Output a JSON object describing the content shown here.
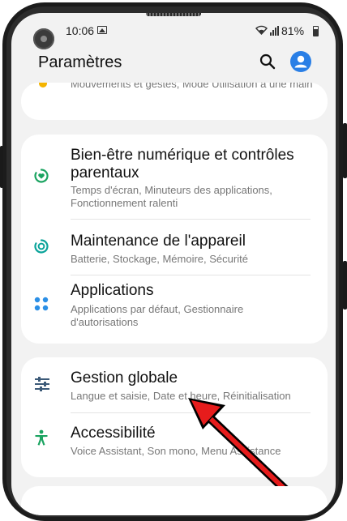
{
  "status_bar": {
    "time": "10:06",
    "battery": "81%"
  },
  "header": {
    "title": "Paramètres"
  },
  "top_card": {
    "partial_text": "Mouvements et gestes, Mode Utilisation à une main"
  },
  "group1": [
    {
      "label": "Bien-être numérique et contrôles parentaux",
      "sub": "Temps d'écran, Minuteurs des applications, Fonctionnement ralenti",
      "icon": "digital-wellbeing-icon"
    },
    {
      "label": "Maintenance de l'appareil",
      "sub": "Batterie, Stockage, Mémoire, Sécurité",
      "icon": "device-care-icon"
    },
    {
      "label": "Applications",
      "sub": "Applications par défaut, Gestionnaire d'autorisations",
      "icon": "apps-icon"
    }
  ],
  "group2": [
    {
      "label": "Gestion globale",
      "sub": "Langue et saisie, Date et heure, Réinitialisation",
      "icon": "sliders-icon"
    },
    {
      "label": "Accessibilité",
      "sub": "Voice Assistant, Son mono, Menu Assistance",
      "icon": "accessibility-icon"
    }
  ],
  "colors": {
    "accent_blue": "#2a7fe6",
    "green": "#1aa360",
    "teal": "#0aa39a",
    "blue_dots": "#2b8fe6",
    "slate": "#3c5a78",
    "arrow_red": "#e61c1c"
  }
}
